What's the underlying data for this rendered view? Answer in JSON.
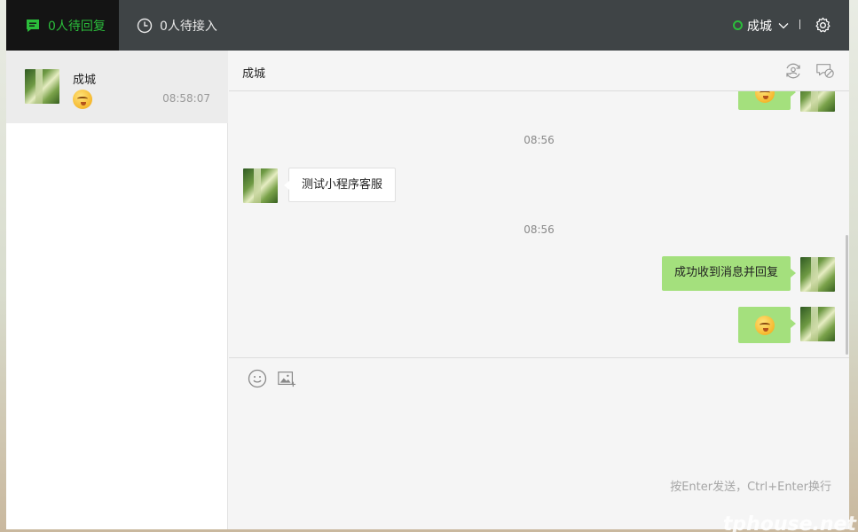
{
  "topbar": {
    "pending_reply_tab": "0人待回复",
    "pending_accept_tab": "0人待接入",
    "user_name": "成城",
    "status_color": "#2bbd3b"
  },
  "conversations": [
    {
      "name": "成城",
      "last_message_emoji": "smiling-emoji",
      "time": "08:58:07"
    }
  ],
  "chat": {
    "title": "成城",
    "messages": [
      {
        "type": "time",
        "text": "08:56"
      },
      {
        "from": "customer",
        "kind": "text",
        "text": "测试小程序客服"
      },
      {
        "type": "time",
        "text": "08:56"
      },
      {
        "from": "agent",
        "kind": "text",
        "text": "成功收到消息并回复"
      },
      {
        "from": "agent",
        "kind": "emoji",
        "emoji": "smiling-emoji"
      }
    ]
  },
  "input": {
    "value": "",
    "hint": "按Enter发送，Ctrl+Enter换行"
  },
  "watermark": "tphouse.net",
  "colors": {
    "topbar_bg": "#3f4446",
    "active_tab_bg": "#141414",
    "accent_green": "#2bbd3b",
    "outgoing_bubble": "#a4e07d"
  }
}
